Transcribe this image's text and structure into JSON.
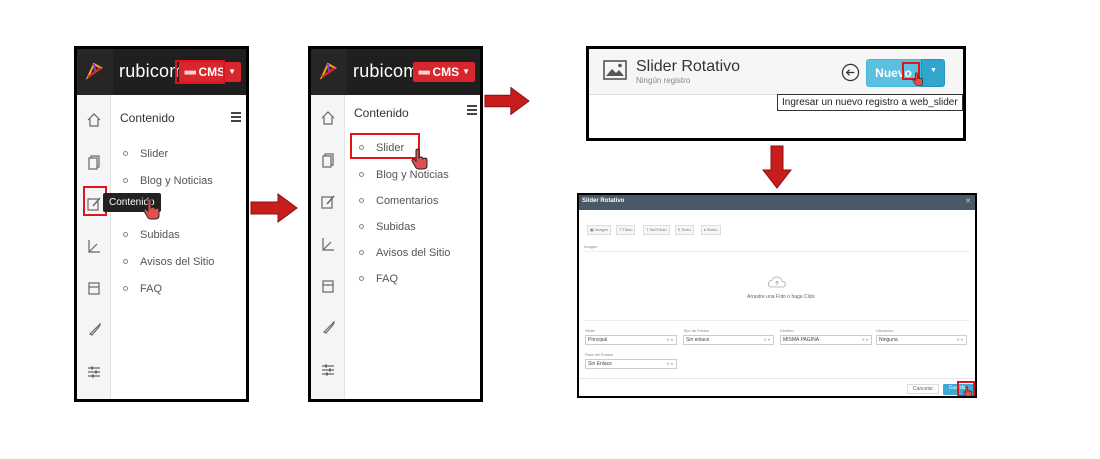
{
  "brand": {
    "name": "rubicom",
    "cms_label": "CMS"
  },
  "panel1": {
    "menu_title": "Contenido",
    "items": [
      "Slider",
      "Blog y Noticias",
      "Subidas",
      "Avisos del Sitio",
      "FAQ"
    ],
    "tooltip": "Contenido"
  },
  "panel2": {
    "menu_title": "Contenido",
    "items": [
      "Slider",
      "Blog y Noticias",
      "Comentarios",
      "Subidas",
      "Avisos del Sitio",
      "FAQ"
    ]
  },
  "header_panel": {
    "title": "Slider Rotativo",
    "subtitle": "Ningún registro",
    "new_button": "Nuevo",
    "tooltip": "Ingresar un nuevo registro a web_slider"
  },
  "modal": {
    "title": "Slider Rotativo",
    "tabs": [
      "Imagen",
      "Título",
      "SubTítulo",
      "Texto",
      "Botón"
    ],
    "image_label": "Imagen",
    "drop_text": "Arrastre una Foto o haga Click",
    "fields": [
      {
        "label": "Slider",
        "value": "Principal"
      },
      {
        "label": "Tipo de Enlace",
        "value": "Sin enlace"
      },
      {
        "label": "Destino",
        "value": "MISMA PAGINA"
      },
      {
        "label": "Ubicación",
        "value": "Ninguna"
      },
      {
        "label": "Ruta del Enlace",
        "value": "Sin Enlace"
      }
    ],
    "cancel": "Cancelar",
    "save": "Guardar"
  },
  "colors": {
    "accent_red": "#d8262d",
    "arrow_red": "#c81d1d",
    "primary_blue": "#5bc0de",
    "dark_bar": "#1f1f1f"
  },
  "icons": [
    "logo-icon",
    "home-icon",
    "pages-icon",
    "edit-icon",
    "chart-icon",
    "calendar-icon",
    "rocket-icon",
    "sliders-icon",
    "image-icon",
    "back-icon",
    "upload-cloud-icon",
    "hand-cursor-icon"
  ]
}
